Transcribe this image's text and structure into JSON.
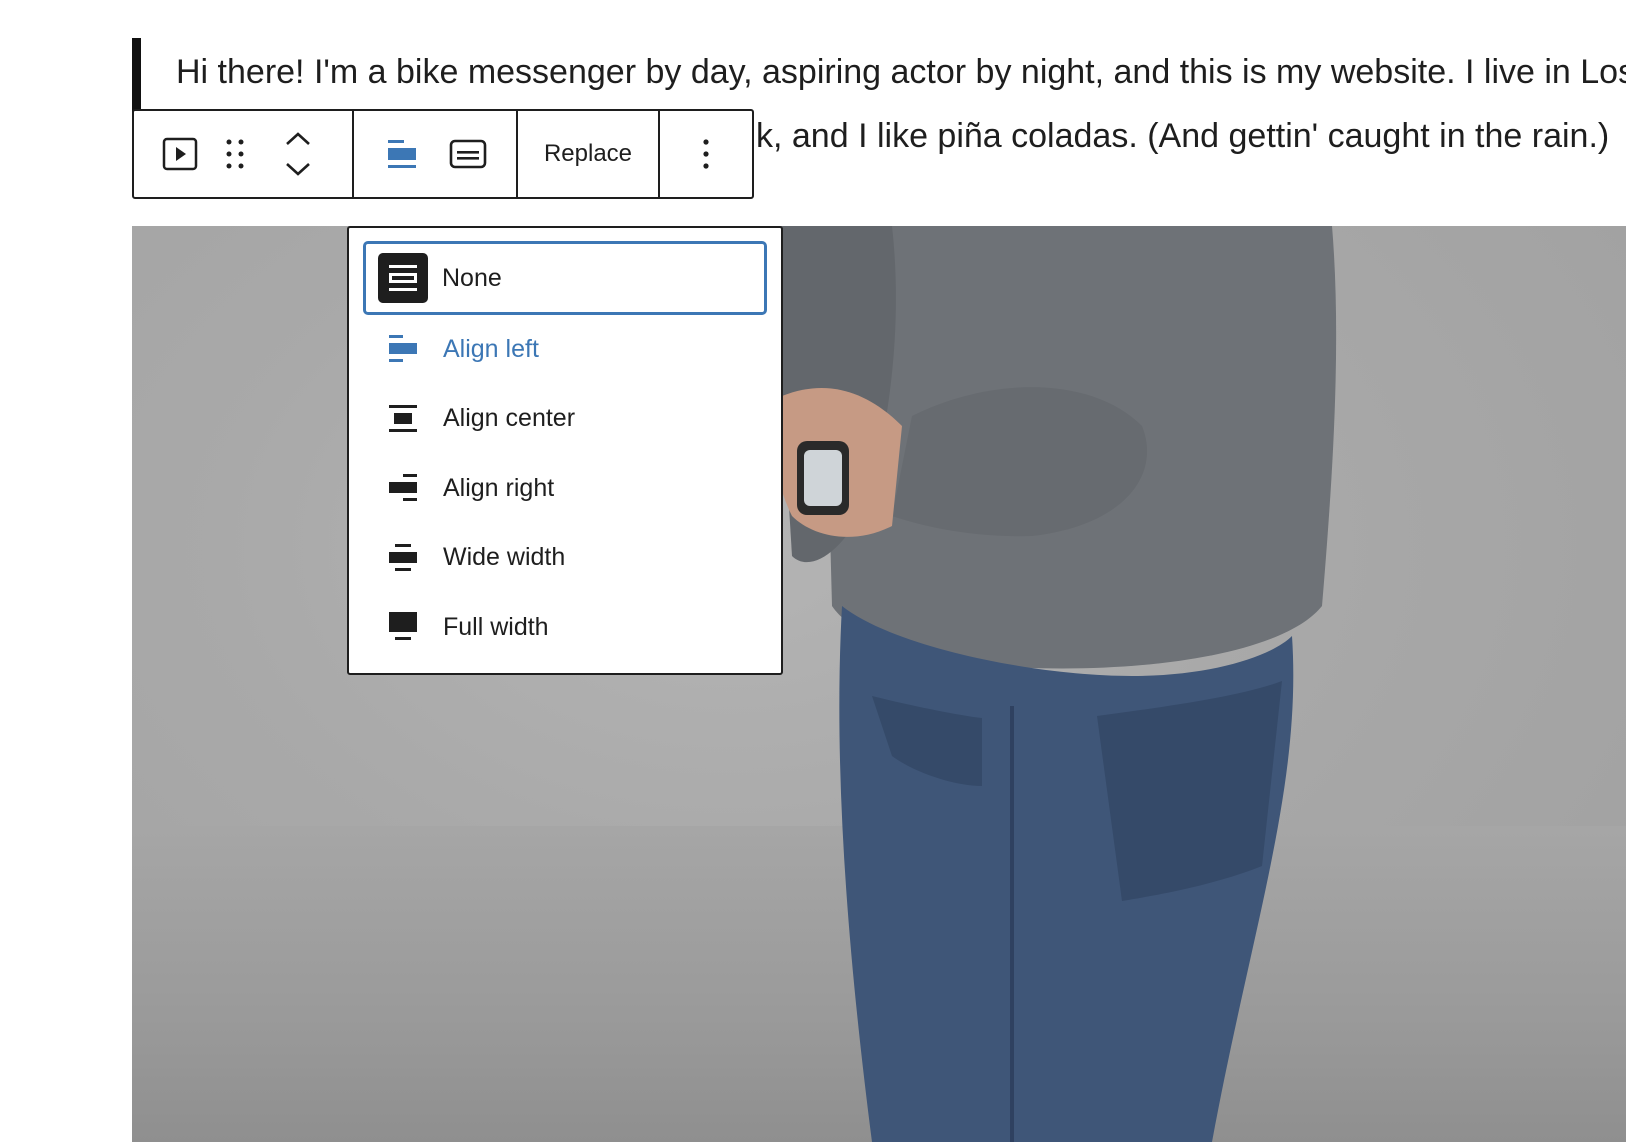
{
  "paragraph": {
    "line1": "Hi there! I'm a bike messenger by day, aspiring actor by night, and this is my website. I live in Los Angeles,",
    "line2_visible": "k, and I like piña coladas. (And gettin' caught in the rain.)"
  },
  "toolbar": {
    "block_type_icon": "video-icon",
    "drag_icon": "drag-handle-icon",
    "move_up_icon": "chevron-up-icon",
    "move_down_icon": "chevron-down-icon",
    "align_icon": "align-left-icon",
    "caption_icon": "caption-icon",
    "replace_label": "Replace",
    "more_icon": "more-vertical-icon"
  },
  "alignment_menu": {
    "items": [
      {
        "label": "None",
        "icon": "align-none-icon",
        "state": "selected"
      },
      {
        "label": "Align left",
        "icon": "align-left-icon",
        "state": "active"
      },
      {
        "label": "Align center",
        "icon": "align-center-icon",
        "state": "normal"
      },
      {
        "label": "Align right",
        "icon": "align-right-icon",
        "state": "normal"
      },
      {
        "label": "Wide width",
        "icon": "align-wide-icon",
        "state": "normal"
      },
      {
        "label": "Full width",
        "icon": "align-full-icon",
        "state": "normal"
      }
    ]
  },
  "colors": {
    "accent": "#3c77b5",
    "text": "#1e1e1e",
    "border": "#1e1e1e"
  }
}
